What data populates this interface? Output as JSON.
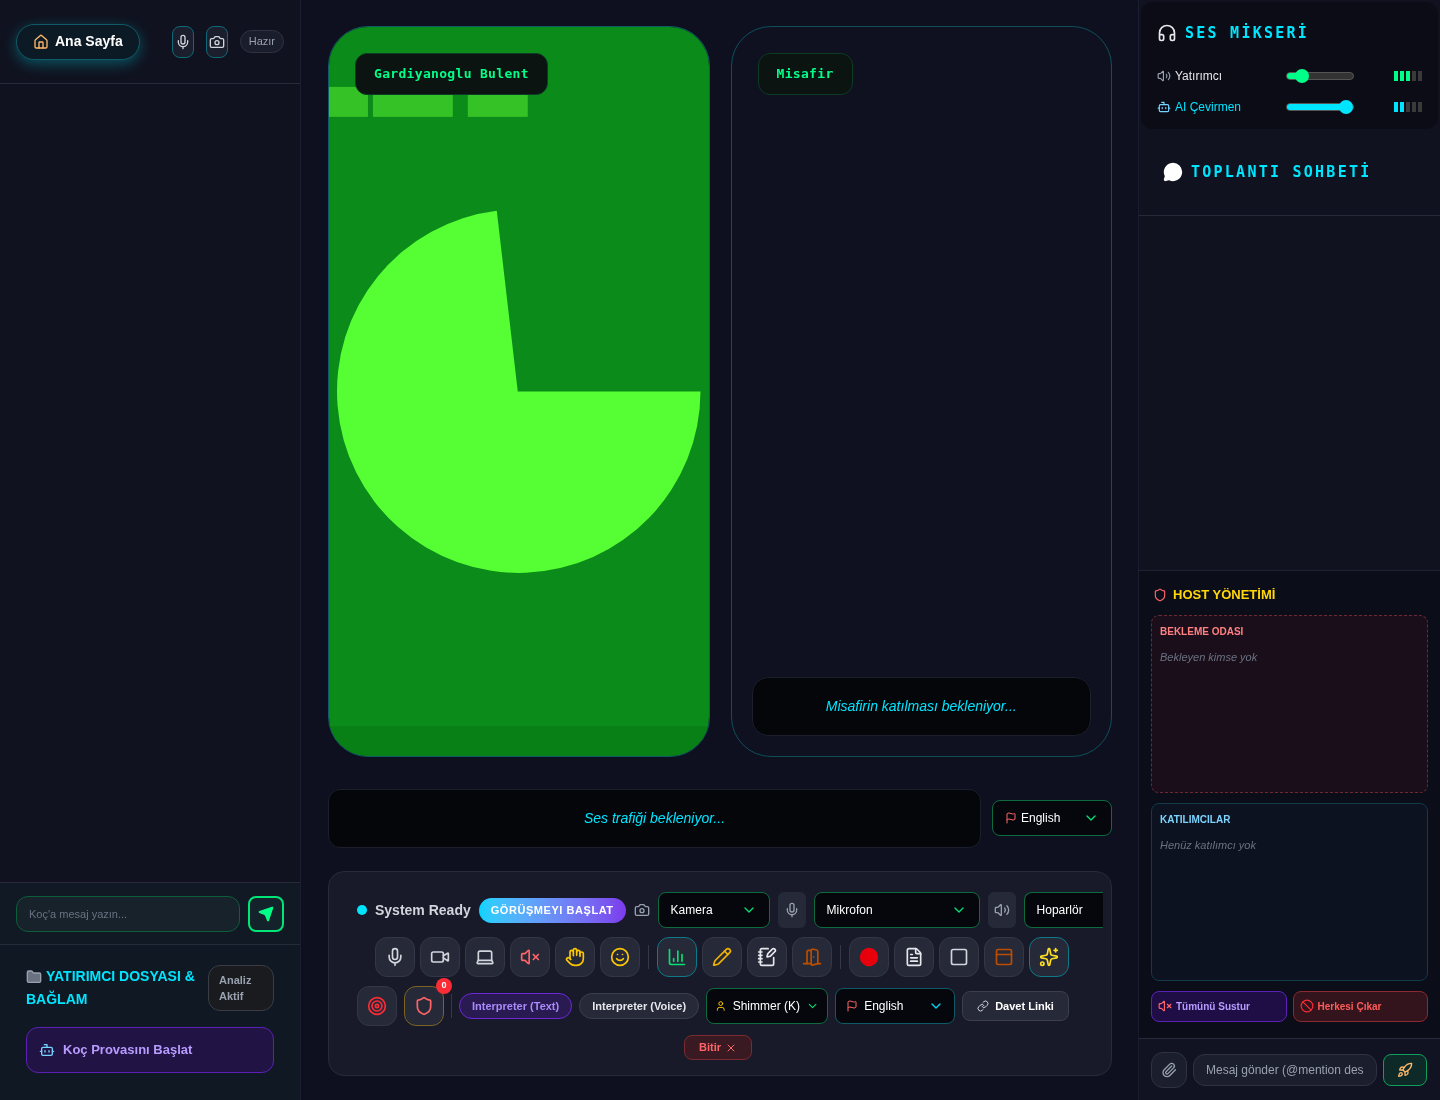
{
  "sidebar": {
    "home_button": "Ana Sayfa",
    "status_badge": "Hazır",
    "coach_input": {
      "placeholder": "Koç'a mesaj yazın..."
    },
    "dossier": {
      "title": "YATIRIMCI DOSYASI & BAĞLAM",
      "badge": "Analiz Aktif"
    },
    "rehearsal_button": "Koç Provasını Başlat"
  },
  "video_tiles": [
    {
      "name": "Gardiyanoglu Bulent",
      "kind": "video"
    },
    {
      "name": "Misafir",
      "kind": "waiting",
      "message": "Misafirin katılması bekleniyor..."
    }
  ],
  "transcript": {
    "message": "Ses trafiği bekleniyor...",
    "language": "English"
  },
  "controls": {
    "status": "System Ready",
    "start_button": "GÖRÜŞMEYI BAŞLAT",
    "camera": "Kamera",
    "microphone": "Mikrofon",
    "speaker": "Hoparlör",
    "tool_buttons": [
      {
        "selected": false
      },
      {
        "selected": false
      },
      {
        "selected": false
      },
      {
        "selected": false
      },
      {
        "selected": false
      },
      {
        "selected": false
      },
      {
        "selected": true
      },
      {
        "selected": false
      },
      {
        "selected": false
      },
      {
        "selected": false
      },
      {
        "selected": false
      },
      {
        "selected": false
      },
      {
        "selected": false
      },
      {
        "selected": false
      },
      {
        "selected": true
      }
    ],
    "host_badge": "0",
    "modes": [
      {
        "label": "Interpreter (Text)",
        "selected": true
      },
      {
        "label": "Interpreter (Voice)",
        "selected": false
      }
    ],
    "voice": "Shimmer (K)",
    "language": "English",
    "invite_button": "Davet Linki",
    "end_button": "Bitir"
  },
  "mixer": {
    "title": "SES MİKSERİ",
    "channels": [
      {
        "name": "Yatırımcı",
        "color": "#00ff88",
        "level": 0.22,
        "meter": {
          "level": 0.6
        }
      },
      {
        "name": "AI Çevirmen",
        "color": "#00e5ff",
        "level": 0.9,
        "meter": {
          "level": 0.4
        }
      }
    ]
  },
  "chat": {
    "title": "TOPLANTI SOHBETİ",
    "input": {
      "placeholder": "Mesaj gönder (@mention des"
    }
  },
  "host": {
    "title": "HOST YÖNETİMİ",
    "waiting_room": {
      "title": "BEKLEME ODASI",
      "empty": "Bekleyen kimse yok"
    },
    "participants": {
      "title": "KATILIMCILAR",
      "empty": "Henüz katılımcı yok"
    },
    "mute_all": "Tümünü Sustur",
    "kick_all": "Herkesi Çıkar"
  }
}
